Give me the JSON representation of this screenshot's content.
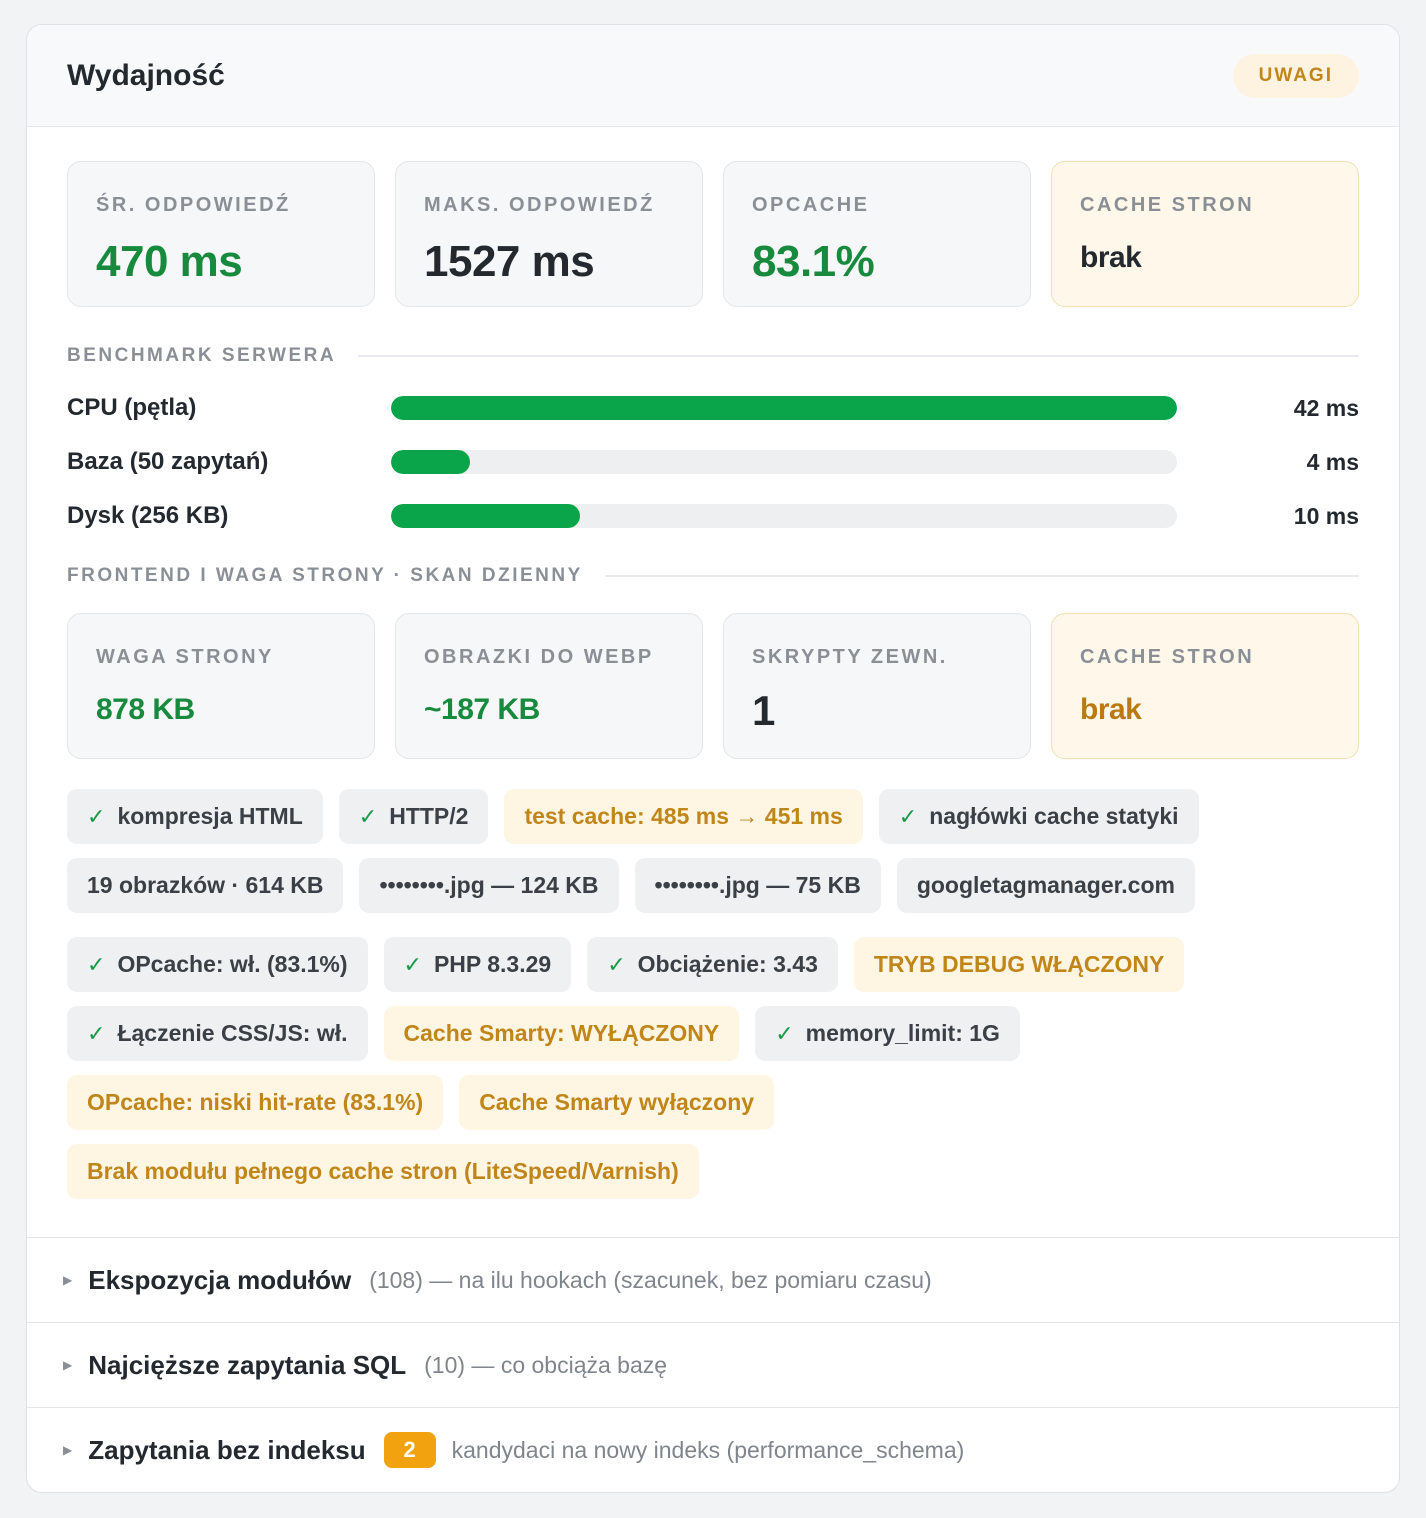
{
  "header": {
    "title": "Wydajność",
    "status": "UWAGI"
  },
  "tiles_top": [
    {
      "label": "ŚR. ODPOWIEDŹ",
      "value": "470 ms"
    },
    {
      "label": "MAKS. ODPOWIEDŹ",
      "value": "1527 ms"
    },
    {
      "label": "OPCACHE",
      "value": "83.1%"
    },
    {
      "label": "CACHE STRON",
      "value": "brak"
    }
  ],
  "benchmark": {
    "title": "BENCHMARK SERWERA",
    "rows": [
      {
        "label": "CPU (pętla)",
        "value": "42 ms",
        "fill_pct": 100
      },
      {
        "label": "Baza (50 zapytań)",
        "value": "4 ms",
        "fill_pct": 10
      },
      {
        "label": "Dysk (256 KB)",
        "value": "10 ms",
        "fill_pct": 24
      }
    ]
  },
  "frontend": {
    "title": "FRONTEND I WAGA STRONY · SKAN DZIENNY",
    "tiles": [
      {
        "label": "WAGA STRONY",
        "value": "878 KB"
      },
      {
        "label": "OBRAZKI DO WEBP",
        "value": "~187 KB"
      },
      {
        "label": "SKRYPTY ZEWN.",
        "value": "1"
      },
      {
        "label": "CACHE STRON",
        "value": "brak"
      }
    ],
    "chips": [
      {
        "text": "kompresja HTML",
        "check": true
      },
      {
        "text": "HTTP/2",
        "check": true
      },
      {
        "text": "test cache: 485 ms → 451 ms",
        "warn": true
      },
      {
        "text": "nagłówki cache statyki",
        "check": true
      },
      {
        "text": "19 obrazków · 614 KB"
      },
      {
        "text": "••••••••.jpg — 124 KB"
      },
      {
        "text": "••••••••.jpg — 75 KB"
      },
      {
        "text": "googletagmanager.com"
      }
    ]
  },
  "server_chips": [
    {
      "text": "OPcache: wł. (83.1%)",
      "check": true
    },
    {
      "text": "PHP 8.3.29",
      "check": true
    },
    {
      "text": "Obciążenie: 3.43",
      "check": true
    },
    {
      "text": "TRYB DEBUG WŁĄCZONY",
      "warn": true
    },
    {
      "text": "Łączenie CSS/JS: wł.",
      "check": true
    },
    {
      "text": "Cache Smarty: WYŁĄCZONY",
      "warn": true
    },
    {
      "text": "memory_limit: 1G",
      "check": true
    },
    {
      "text": "OPcache: niski hit-rate (83.1%)",
      "warn": true
    },
    {
      "text": "Cache Smarty wyłączony",
      "warn": true
    },
    {
      "text": "Brak modułu pełnego cache stron (LiteSpeed/Varnish)",
      "warn": true
    }
  ],
  "sections": [
    {
      "title": "Ekspozycja modułów",
      "sub": "(108) — na ilu hookach (szacunek, bez pomiaru czasu)"
    },
    {
      "title": "Najcięższe zapytania SQL",
      "sub": "(10) — co obciąża bazę"
    },
    {
      "title": "Zapytania bez indeksu",
      "badge": "2",
      "sub": "kandydaci na nowy indeks (performance_schema)"
    }
  ],
  "colors": {
    "green": "#178a3d",
    "bar": "#0aa54b",
    "amber": "#c1861a",
    "badge": "#f2a20f"
  },
  "icons": {
    "check": "check-icon",
    "expand": "triangle-right-icon"
  }
}
